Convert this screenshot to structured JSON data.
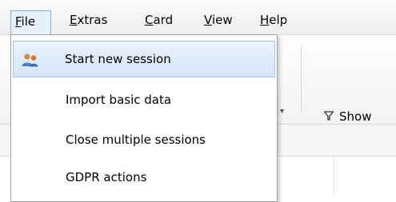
{
  "menubar": {
    "items": [
      {
        "label": "File",
        "mnemonic": "F",
        "rest": "ile",
        "open": true
      },
      {
        "label": "Extras",
        "mnemonic": "E",
        "rest": "xtras"
      },
      {
        "label": "Card",
        "mnemonic": "C",
        "rest": "ard"
      },
      {
        "label": "View",
        "mnemonic": "V",
        "rest": "iew"
      },
      {
        "label": "Help",
        "mnemonic": "H",
        "rest": "elp"
      }
    ]
  },
  "file_menu": {
    "items": [
      {
        "label": "Start new session",
        "icon": "users-icon",
        "highlighted": true
      },
      {
        "label": "Import basic data"
      },
      {
        "label": "Close multiple sessions"
      },
      {
        "label": "GDPR actions"
      }
    ]
  },
  "toolbar": {
    "show_label": "Show",
    "show_icon": "filter-icon"
  },
  "colors": {
    "menu_open_bg": "#e7f1fb",
    "menu_open_border": "#8aaed4",
    "item_highlight": "#d4e4f7",
    "item_highlight_border": "#a9c4e4"
  }
}
